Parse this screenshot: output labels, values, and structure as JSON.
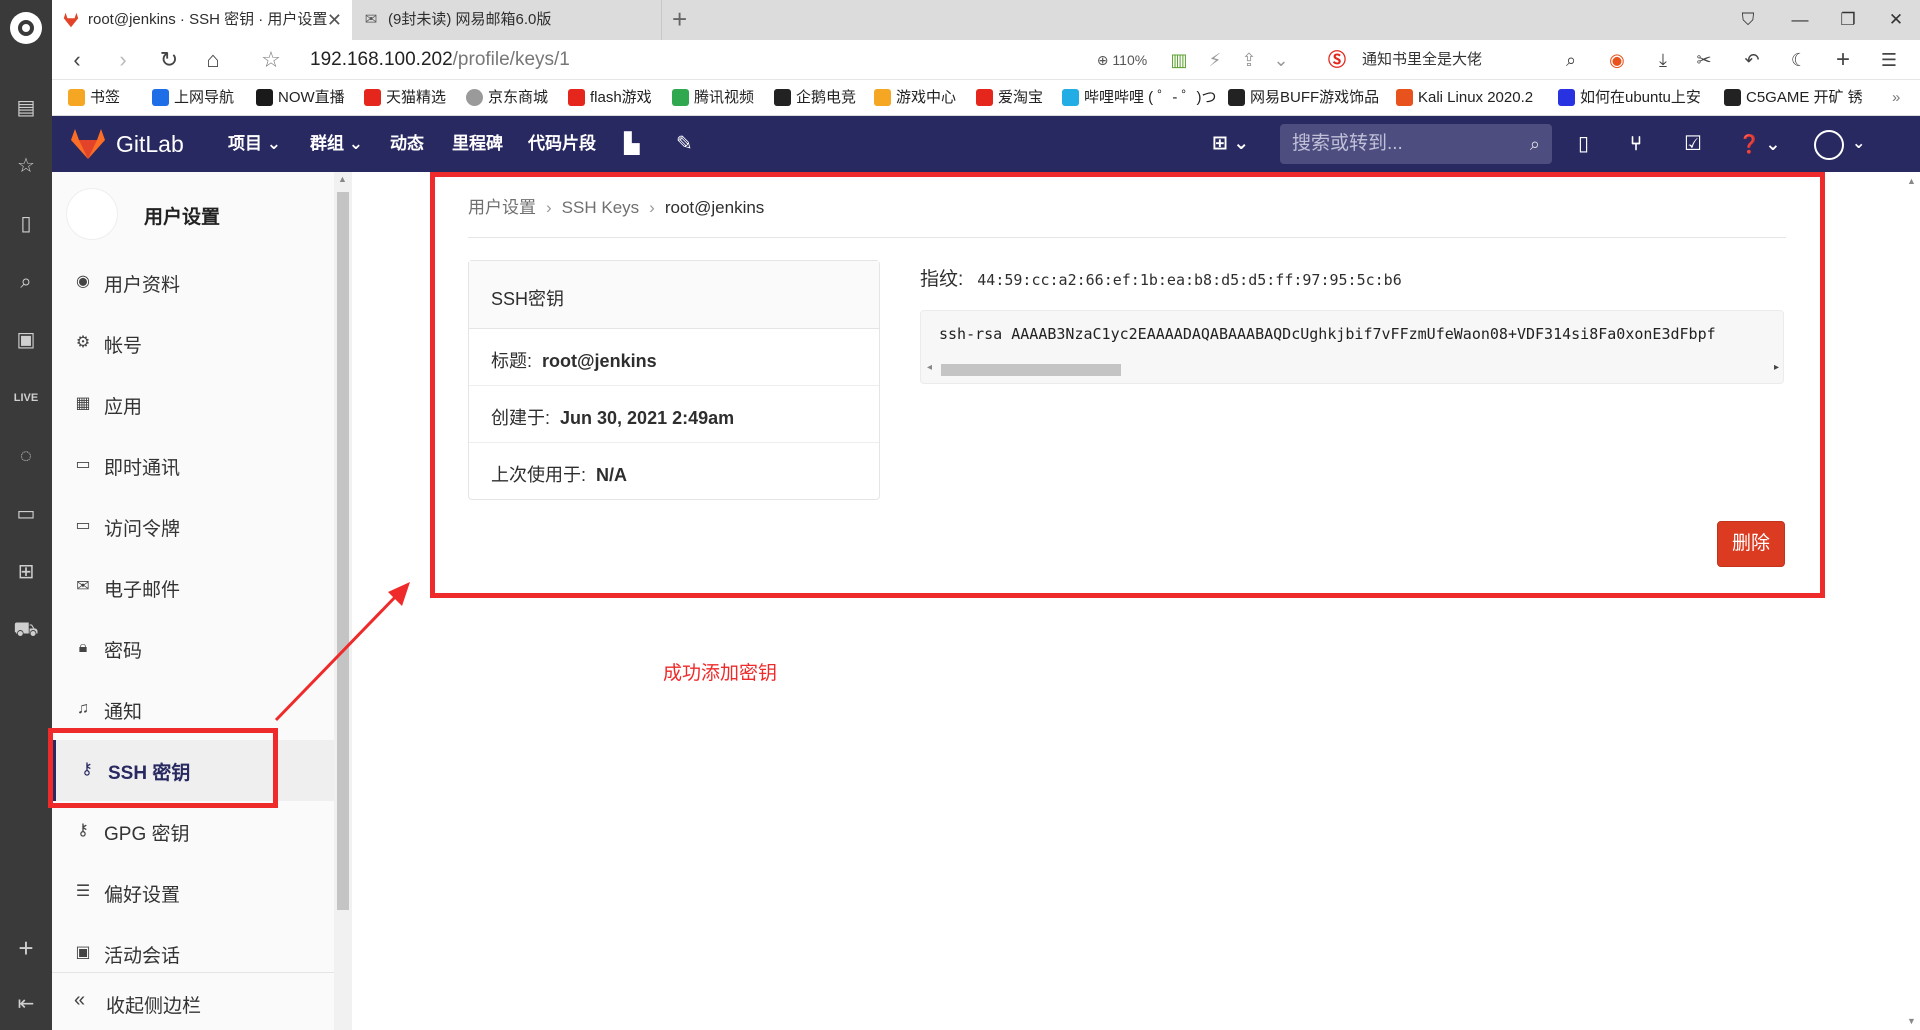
{
  "browser": {
    "tabs": [
      {
        "title": "root@jenkins · SSH 密钥 · 用户设置"
      },
      {
        "title": "(9封未读) 网易邮箱6.0版"
      }
    ],
    "url_host": "192.168.100.202",
    "url_path": "/profile/keys/1",
    "zoom": "110%",
    "search_hint": "通知书里全是大佬",
    "bookmarks": [
      {
        "label": "书签",
        "color": "#f5a623"
      },
      {
        "label": "上网导航",
        "color": "#1e6ee8"
      },
      {
        "label": "NOW直播",
        "color": "#1a1a1a"
      },
      {
        "label": "天猫精选",
        "color": "#e4261c"
      },
      {
        "label": "京东商城",
        "color": "#9a9a9a"
      },
      {
        "label": "flash游戏",
        "color": "#e4261c"
      },
      {
        "label": "腾讯视频",
        "color": "#2fa84f"
      },
      {
        "label": "企鹅电竞",
        "color": "#222222"
      },
      {
        "label": "游戏中心",
        "color": "#f5a623"
      },
      {
        "label": "爱淘宝",
        "color": "#e4261c"
      },
      {
        "label": "哔哩哔哩 ( ゜- ゜)つ",
        "color": "#23ade5"
      },
      {
        "label": "网易BUFF游戏饰品",
        "color": "#222222"
      },
      {
        "label": "Kali Linux 2020.2",
        "color": "#e8521c"
      },
      {
        "label": "如何在ubuntu上安",
        "color": "#2932e1"
      },
      {
        "label": "C5GAME 开矿 锈",
        "color": "#222222"
      }
    ]
  },
  "gitlab": {
    "brand": "GitLab",
    "nav": [
      "项目",
      "群组",
      "动态",
      "里程碑",
      "代码片段"
    ],
    "search_placeholder": "搜索或转到...",
    "header_color": "#292961"
  },
  "sidebar": {
    "title": "用户设置",
    "items": [
      {
        "label": "用户资料",
        "icon": "profile-icon"
      },
      {
        "label": "帐号",
        "icon": "account-icon"
      },
      {
        "label": "应用",
        "icon": "applications-icon"
      },
      {
        "label": "即时通讯",
        "icon": "chat-icon"
      },
      {
        "label": "访问令牌",
        "icon": "token-icon"
      },
      {
        "label": "电子邮件",
        "icon": "email-icon"
      },
      {
        "label": "密码",
        "icon": "lock-icon"
      },
      {
        "label": "通知",
        "icon": "notification-icon"
      },
      {
        "label": "SSH 密钥",
        "icon": "key-icon",
        "active": true
      },
      {
        "label": "GPG 密钥",
        "icon": "key-icon"
      },
      {
        "label": "偏好设置",
        "icon": "preferences-icon"
      },
      {
        "label": "活动会话",
        "icon": "session-icon"
      }
    ],
    "collapse": "收起侧边栏"
  },
  "breadcrumb": [
    "用户设置",
    "SSH Keys",
    "root@jenkins"
  ],
  "key": {
    "card_title": "SSH密钥",
    "title_label": "标题:",
    "title_value": "root@jenkins",
    "created_label": "创建于:",
    "created_value": "Jun 30, 2021 2:49am",
    "last_used_label": "上次使用于:",
    "last_used_value": "N/A",
    "fingerprint_label": "指纹:",
    "fingerprint": "44:59:cc:a2:66:ef:1b:ea:b8:d5:d5:ff:97:95:5c:b6",
    "public_key": "ssh-rsa AAAAB3NzaC1yc2EAAAADAQABAAABAQDcUghkjbif7vFFzmUfeWaon08+VDF314si8Fa0xonE3dFbpf",
    "delete_label": "删除",
    "delete_color": "#db3b21"
  },
  "annotation": {
    "note": "成功添加密钥",
    "color": "#ee2a2a"
  }
}
